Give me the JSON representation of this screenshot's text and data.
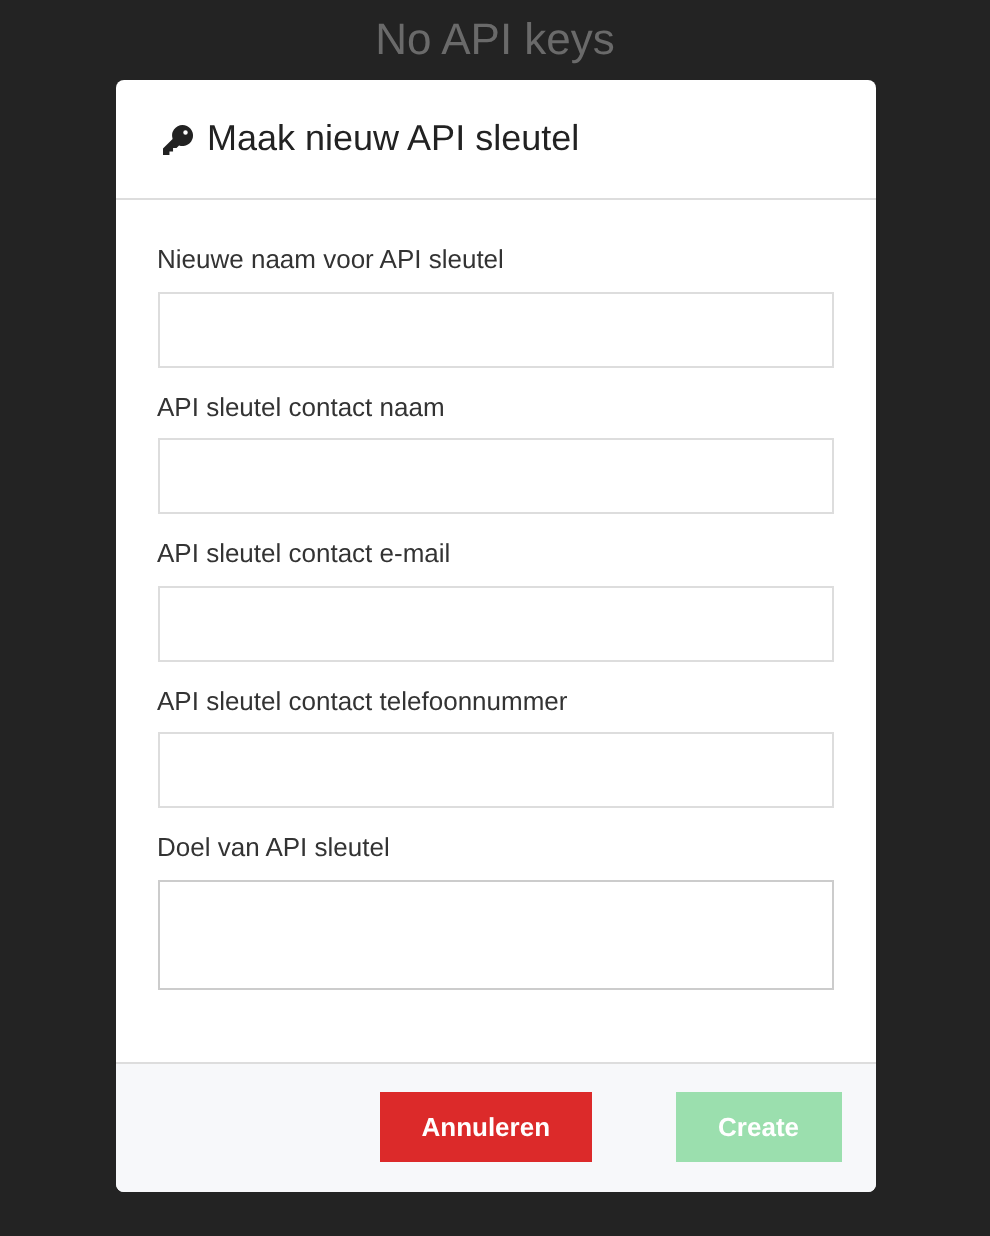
{
  "page_heading": "No API keys",
  "dialog": {
    "title": "Maak nieuw API sleutel",
    "fields": [
      {
        "label": "Nieuwe naam voor API sleutel",
        "kind": "input"
      },
      {
        "label": "API sleutel contact naam",
        "kind": "input"
      },
      {
        "label": "API sleutel contact e-mail",
        "kind": "input"
      },
      {
        "label": "API sleutel contact telefoonnummer",
        "kind": "input"
      },
      {
        "label": "Doel van API sleutel",
        "kind": "textarea"
      }
    ],
    "buttons": [
      {
        "label": "Annuleren",
        "kind": "cancel",
        "disabled": false
      },
      {
        "label": "Create",
        "kind": "create",
        "disabled": true
      }
    ]
  }
}
